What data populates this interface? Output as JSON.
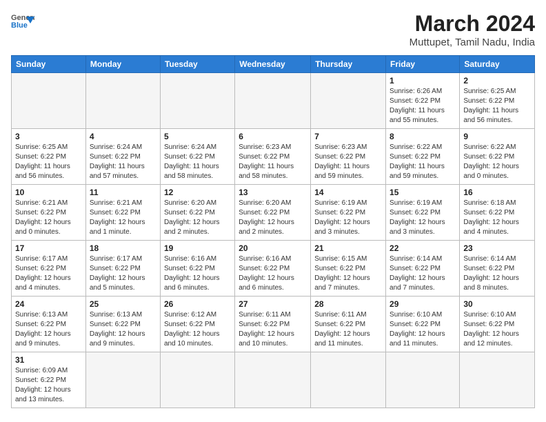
{
  "logo": {
    "text_general": "General",
    "text_blue": "Blue"
  },
  "title": "March 2024",
  "subtitle": "Muttupet, Tamil Nadu, India",
  "days_of_week": [
    "Sunday",
    "Monday",
    "Tuesday",
    "Wednesday",
    "Thursday",
    "Friday",
    "Saturday"
  ],
  "weeks": [
    [
      {
        "day": "",
        "info": ""
      },
      {
        "day": "",
        "info": ""
      },
      {
        "day": "",
        "info": ""
      },
      {
        "day": "",
        "info": ""
      },
      {
        "day": "",
        "info": ""
      },
      {
        "day": "1",
        "info": "Sunrise: 6:26 AM\nSunset: 6:22 PM\nDaylight: 11 hours and 55 minutes."
      },
      {
        "day": "2",
        "info": "Sunrise: 6:25 AM\nSunset: 6:22 PM\nDaylight: 11 hours and 56 minutes."
      }
    ],
    [
      {
        "day": "3",
        "info": "Sunrise: 6:25 AM\nSunset: 6:22 PM\nDaylight: 11 hours and 56 minutes."
      },
      {
        "day": "4",
        "info": "Sunrise: 6:24 AM\nSunset: 6:22 PM\nDaylight: 11 hours and 57 minutes."
      },
      {
        "day": "5",
        "info": "Sunrise: 6:24 AM\nSunset: 6:22 PM\nDaylight: 11 hours and 58 minutes."
      },
      {
        "day": "6",
        "info": "Sunrise: 6:23 AM\nSunset: 6:22 PM\nDaylight: 11 hours and 58 minutes."
      },
      {
        "day": "7",
        "info": "Sunrise: 6:23 AM\nSunset: 6:22 PM\nDaylight: 11 hours and 59 minutes."
      },
      {
        "day": "8",
        "info": "Sunrise: 6:22 AM\nSunset: 6:22 PM\nDaylight: 11 hours and 59 minutes."
      },
      {
        "day": "9",
        "info": "Sunrise: 6:22 AM\nSunset: 6:22 PM\nDaylight: 12 hours and 0 minutes."
      }
    ],
    [
      {
        "day": "10",
        "info": "Sunrise: 6:21 AM\nSunset: 6:22 PM\nDaylight: 12 hours and 0 minutes."
      },
      {
        "day": "11",
        "info": "Sunrise: 6:21 AM\nSunset: 6:22 PM\nDaylight: 12 hours and 1 minute."
      },
      {
        "day": "12",
        "info": "Sunrise: 6:20 AM\nSunset: 6:22 PM\nDaylight: 12 hours and 2 minutes."
      },
      {
        "day": "13",
        "info": "Sunrise: 6:20 AM\nSunset: 6:22 PM\nDaylight: 12 hours and 2 minutes."
      },
      {
        "day": "14",
        "info": "Sunrise: 6:19 AM\nSunset: 6:22 PM\nDaylight: 12 hours and 3 minutes."
      },
      {
        "day": "15",
        "info": "Sunrise: 6:19 AM\nSunset: 6:22 PM\nDaylight: 12 hours and 3 minutes."
      },
      {
        "day": "16",
        "info": "Sunrise: 6:18 AM\nSunset: 6:22 PM\nDaylight: 12 hours and 4 minutes."
      }
    ],
    [
      {
        "day": "17",
        "info": "Sunrise: 6:17 AM\nSunset: 6:22 PM\nDaylight: 12 hours and 4 minutes."
      },
      {
        "day": "18",
        "info": "Sunrise: 6:17 AM\nSunset: 6:22 PM\nDaylight: 12 hours and 5 minutes."
      },
      {
        "day": "19",
        "info": "Sunrise: 6:16 AM\nSunset: 6:22 PM\nDaylight: 12 hours and 6 minutes."
      },
      {
        "day": "20",
        "info": "Sunrise: 6:16 AM\nSunset: 6:22 PM\nDaylight: 12 hours and 6 minutes."
      },
      {
        "day": "21",
        "info": "Sunrise: 6:15 AM\nSunset: 6:22 PM\nDaylight: 12 hours and 7 minutes."
      },
      {
        "day": "22",
        "info": "Sunrise: 6:14 AM\nSunset: 6:22 PM\nDaylight: 12 hours and 7 minutes."
      },
      {
        "day": "23",
        "info": "Sunrise: 6:14 AM\nSunset: 6:22 PM\nDaylight: 12 hours and 8 minutes."
      }
    ],
    [
      {
        "day": "24",
        "info": "Sunrise: 6:13 AM\nSunset: 6:22 PM\nDaylight: 12 hours and 9 minutes."
      },
      {
        "day": "25",
        "info": "Sunrise: 6:13 AM\nSunset: 6:22 PM\nDaylight: 12 hours and 9 minutes."
      },
      {
        "day": "26",
        "info": "Sunrise: 6:12 AM\nSunset: 6:22 PM\nDaylight: 12 hours and 10 minutes."
      },
      {
        "day": "27",
        "info": "Sunrise: 6:11 AM\nSunset: 6:22 PM\nDaylight: 12 hours and 10 minutes."
      },
      {
        "day": "28",
        "info": "Sunrise: 6:11 AM\nSunset: 6:22 PM\nDaylight: 12 hours and 11 minutes."
      },
      {
        "day": "29",
        "info": "Sunrise: 6:10 AM\nSunset: 6:22 PM\nDaylight: 12 hours and 11 minutes."
      },
      {
        "day": "30",
        "info": "Sunrise: 6:10 AM\nSunset: 6:22 PM\nDaylight: 12 hours and 12 minutes."
      }
    ],
    [
      {
        "day": "31",
        "info": "Sunrise: 6:09 AM\nSunset: 6:22 PM\nDaylight: 12 hours and 13 minutes."
      },
      {
        "day": "",
        "info": ""
      },
      {
        "day": "",
        "info": ""
      },
      {
        "day": "",
        "info": ""
      },
      {
        "day": "",
        "info": ""
      },
      {
        "day": "",
        "info": ""
      },
      {
        "day": "",
        "info": ""
      }
    ]
  ]
}
